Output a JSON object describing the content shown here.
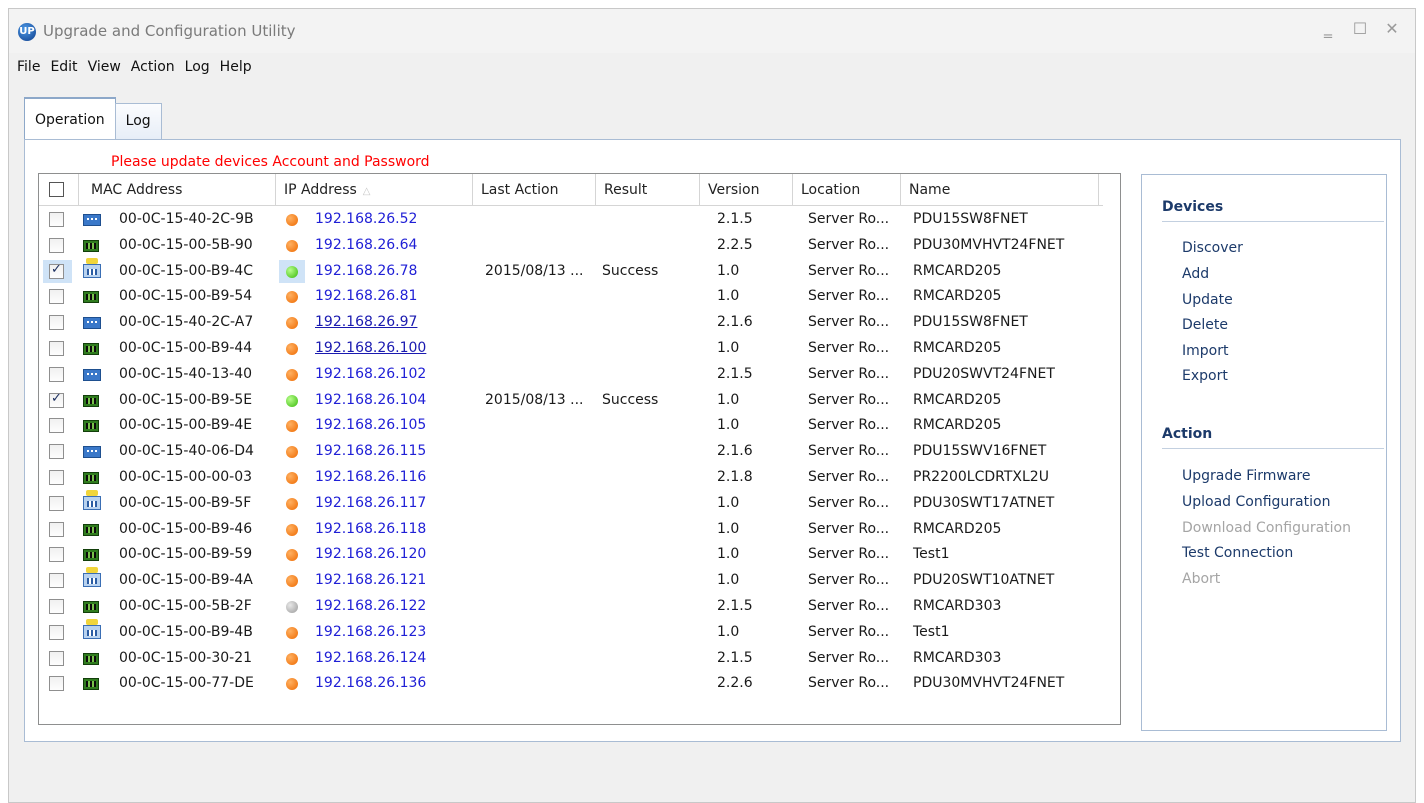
{
  "window": {
    "title": "Upgrade and Configuration Utility"
  },
  "menu": [
    "File",
    "Edit",
    "View",
    "Action",
    "Log",
    "Help"
  ],
  "tabs": [
    {
      "label": "Operation",
      "active": true
    },
    {
      "label": "Log",
      "active": false
    }
  ],
  "notice": "Please update devices Account and Password",
  "columns": [
    "MAC Address",
    "IP Address",
    "Last Action",
    "Result",
    "Version",
    "Location",
    "Name"
  ],
  "sort_column": "IP Address",
  "rows": [
    {
      "checked": false,
      "icon": "pdu-icon",
      "mac": "00-0C-15-40-2C-9B",
      "status": "orange",
      "ip": "192.168.26.52",
      "last_action": "",
      "result": "",
      "version": "2.1.5",
      "location": "Server Ro...",
      "name": "PDU15SW8FNET"
    },
    {
      "checked": false,
      "icon": "card-icon",
      "mac": "00-0C-15-00-5B-90",
      "status": "orange",
      "ip": "192.168.26.64",
      "last_action": "",
      "result": "",
      "version": "2.2.5",
      "location": "Server Ro...",
      "name": "PDU30MVHVT24FNET"
    },
    {
      "checked": true,
      "icon": "ups-icon",
      "mac": "00-0C-15-00-B9-4C",
      "status": "green",
      "ip": "192.168.26.78",
      "last_action": "2015/08/13 ...",
      "result": "Success",
      "version": "1.0",
      "location": "Server Ro...",
      "name": "RMCARD205",
      "focused": true
    },
    {
      "checked": false,
      "icon": "card-icon",
      "mac": "00-0C-15-00-B9-54",
      "status": "orange",
      "ip": "192.168.26.81",
      "last_action": "",
      "result": "",
      "version": "1.0",
      "location": "Server Ro...",
      "name": "RMCARD205"
    },
    {
      "checked": false,
      "icon": "pdu-icon",
      "mac": "00-0C-15-40-2C-A7",
      "status": "orange",
      "ip": "192.168.26.97",
      "last_action": "",
      "result": "",
      "version": "2.1.6",
      "location": "Server Ro...",
      "name": "PDU15SW8FNET",
      "link": true
    },
    {
      "checked": false,
      "icon": "card-icon",
      "mac": "00-0C-15-00-B9-44",
      "status": "orange",
      "ip": "192.168.26.100",
      "last_action": "",
      "result": "",
      "version": "1.0",
      "location": "Server Ro...",
      "name": "RMCARD205",
      "link": true
    },
    {
      "checked": false,
      "icon": "pdu-icon",
      "mac": "00-0C-15-40-13-40",
      "status": "orange",
      "ip": "192.168.26.102",
      "last_action": "",
      "result": "",
      "version": "2.1.5",
      "location": "Server Ro...",
      "name": "PDU20SWVT24FNET"
    },
    {
      "checked": true,
      "icon": "card-icon",
      "mac": "00-0C-15-00-B9-5E",
      "status": "green",
      "ip": "192.168.26.104",
      "last_action": "2015/08/13 ...",
      "result": "Success",
      "version": "1.0",
      "location": "Server Ro...",
      "name": "RMCARD205"
    },
    {
      "checked": false,
      "icon": "card-icon",
      "mac": "00-0C-15-00-B9-4E",
      "status": "orange",
      "ip": "192.168.26.105",
      "last_action": "",
      "result": "",
      "version": "1.0",
      "location": "Server Ro...",
      "name": "RMCARD205"
    },
    {
      "checked": false,
      "icon": "pdu-icon",
      "mac": "00-0C-15-40-06-D4",
      "status": "orange",
      "ip": "192.168.26.115",
      "last_action": "",
      "result": "",
      "version": "2.1.6",
      "location": "Server Ro...",
      "name": "PDU15SWV16FNET"
    },
    {
      "checked": false,
      "icon": "card-icon",
      "mac": "00-0C-15-00-00-03",
      "status": "orange",
      "ip": "192.168.26.116",
      "last_action": "",
      "result": "",
      "version": "2.1.8",
      "location": "Server Ro...",
      "name": "PR2200LCDRTXL2U"
    },
    {
      "checked": false,
      "icon": "ups-icon",
      "mac": "00-0C-15-00-B9-5F",
      "status": "orange",
      "ip": "192.168.26.117",
      "last_action": "",
      "result": "",
      "version": "1.0",
      "location": "Server Ro...",
      "name": "PDU30SWT17ATNET"
    },
    {
      "checked": false,
      "icon": "card-icon",
      "mac": "00-0C-15-00-B9-46",
      "status": "orange",
      "ip": "192.168.26.118",
      "last_action": "",
      "result": "",
      "version": "1.0",
      "location": "Server Ro...",
      "name": "RMCARD205"
    },
    {
      "checked": false,
      "icon": "card-icon",
      "mac": "00-0C-15-00-B9-59",
      "status": "orange",
      "ip": "192.168.26.120",
      "last_action": "",
      "result": "",
      "version": "1.0",
      "location": "Server Ro...",
      "name": "Test1"
    },
    {
      "checked": false,
      "icon": "ups-icon",
      "mac": "00-0C-15-00-B9-4A",
      "status": "orange",
      "ip": "192.168.26.121",
      "last_action": "",
      "result": "",
      "version": "1.0",
      "location": "Server Ro...",
      "name": "PDU20SWT10ATNET"
    },
    {
      "checked": false,
      "icon": "card-icon",
      "mac": "00-0C-15-00-5B-2F",
      "status": "gray",
      "ip": "192.168.26.122",
      "last_action": "",
      "result": "",
      "version": "2.1.5",
      "location": "Server Ro...",
      "name": "RMCARD303"
    },
    {
      "checked": false,
      "icon": "ups-icon",
      "mac": "00-0C-15-00-B9-4B",
      "status": "orange",
      "ip": "192.168.26.123",
      "last_action": "",
      "result": "",
      "version": "1.0",
      "location": "Server Ro...",
      "name": "Test1"
    },
    {
      "checked": false,
      "icon": "card-icon",
      "mac": "00-0C-15-00-30-21",
      "status": "orange",
      "ip": "192.168.26.124",
      "last_action": "",
      "result": "",
      "version": "2.1.5",
      "location": "Server Ro...",
      "name": "RMCARD303"
    },
    {
      "checked": false,
      "icon": "card-icon",
      "mac": "00-0C-15-00-77-DE",
      "status": "orange",
      "ip": "192.168.26.136",
      "last_action": "",
      "result": "",
      "version": "2.2.6",
      "location": "Server Ro...",
      "name": "PDU30MVHVT24FNET"
    }
  ],
  "side": {
    "devices_title": "Devices",
    "devices": [
      {
        "label": "Discover",
        "enabled": true
      },
      {
        "label": "Add",
        "enabled": true
      },
      {
        "label": "Update",
        "enabled": true
      },
      {
        "label": "Delete",
        "enabled": true
      },
      {
        "label": "Import",
        "enabled": true
      },
      {
        "label": "Export",
        "enabled": true
      }
    ],
    "action_title": "Action",
    "actions": [
      {
        "label": "Upgrade Firmware",
        "enabled": true
      },
      {
        "label": "Upload Configuration",
        "enabled": true
      },
      {
        "label": "Download Configuration",
        "enabled": false
      },
      {
        "label": "Test Connection",
        "enabled": true
      },
      {
        "label": "Abort",
        "enabled": false
      }
    ]
  },
  "colors": {
    "notice": "#ff0000",
    "ip_link": "#1f1fd6",
    "status_orange": "#ee6a00",
    "status_green": "#37b80a",
    "status_gray": "#9a9a9a"
  }
}
